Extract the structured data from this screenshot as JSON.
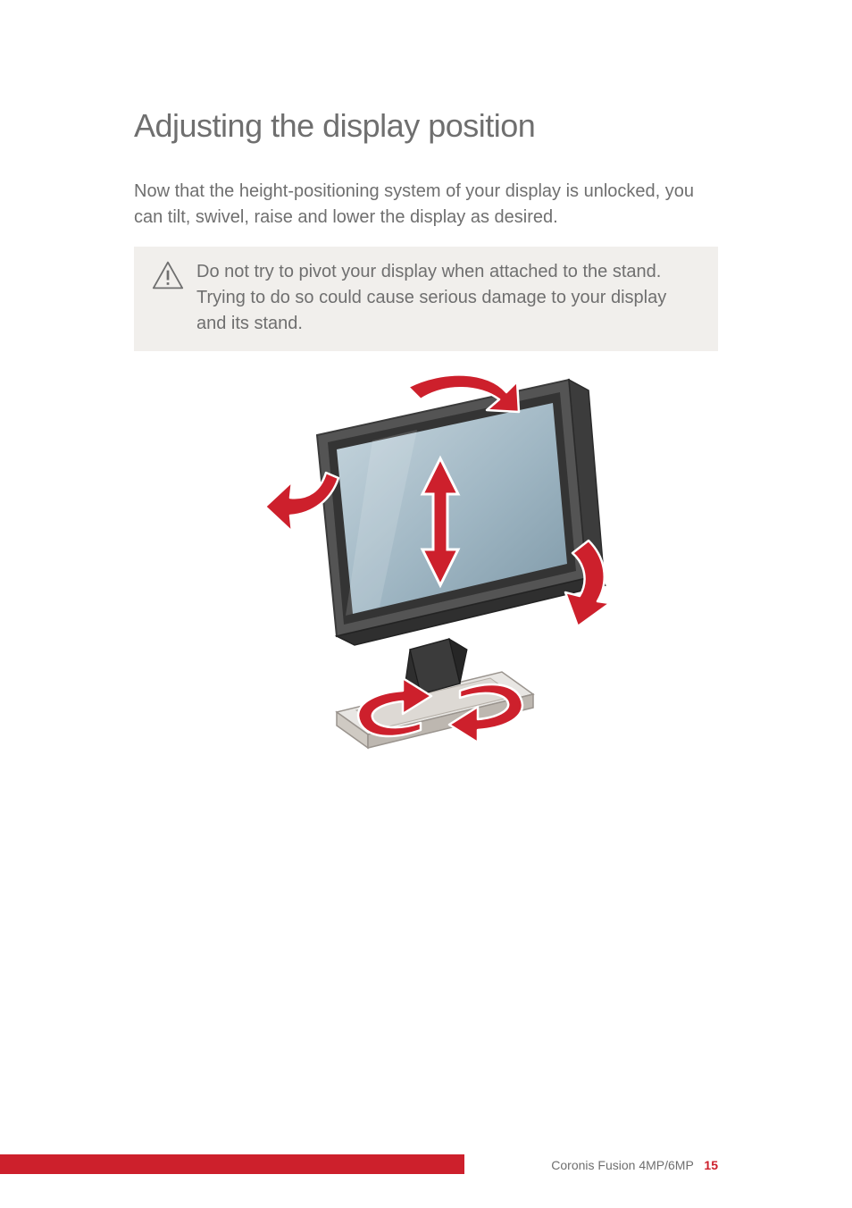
{
  "heading": "Adjusting the display position",
  "intro": "Now that the height-positioning system of your display is unlocked, you can tilt, swivel, raise and lower the display as desired.",
  "warning": {
    "text": "Do not try to pivot your display when attached to the stand. Trying to do so could cause serious damage to your display and its stand."
  },
  "figure_alt": "Illustration of a monitor on a stand with red arrows indicating tilt, swivel, raise and lower adjustment directions.",
  "footer": {
    "product": "Coronis Fusion 4MP/6MP",
    "page": "15"
  }
}
